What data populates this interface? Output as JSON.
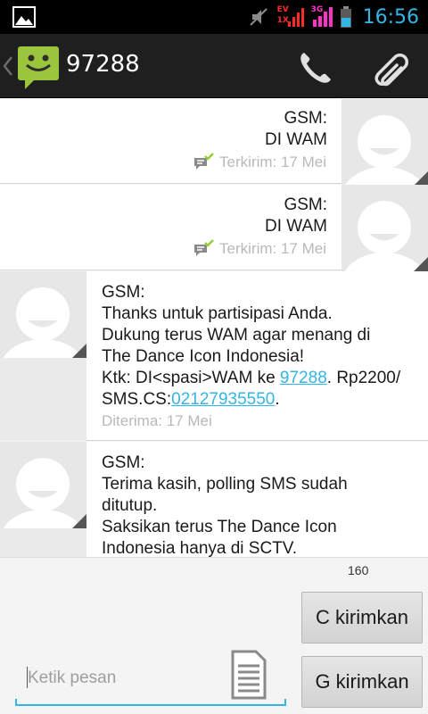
{
  "status_bar": {
    "time": "16:56",
    "icons": [
      "gallery-icon",
      "mute-icon",
      "signal-ev-icon",
      "signal-3g-icon",
      "battery-icon"
    ],
    "network_label_top": "EV",
    "network_label_bottom": "1X",
    "data_label": "3G"
  },
  "action_bar": {
    "title": "97288",
    "icons": [
      "back-caret-icon",
      "messaging-app-icon",
      "phone-icon",
      "paperclip-icon"
    ]
  },
  "messages": [
    {
      "direction": "sent",
      "lines": [
        "GSM:",
        "DI WAM"
      ],
      "status": "Terkirim: 17 Mei"
    },
    {
      "direction": "sent",
      "lines": [
        "GSM:",
        "DI WAM"
      ],
      "status": "Terkirim: 17 Mei"
    },
    {
      "direction": "received",
      "lines": [
        "GSM:",
        "Thanks untuk partisipasi Anda.",
        "Dukung terus WAM agar menang di",
        "The Dance Icon Indonesia!"
      ],
      "line5_prefix": "Ktk: DI<spasi>WAM ke ",
      "line5_link": "97288",
      "line5_suffix": ". Rp2200/",
      "line6_prefix": "SMS.CS:",
      "line6_link": "02127935550",
      "line6_suffix": ".",
      "status": "Diterima: 17 Mei"
    },
    {
      "direction": "received",
      "lines": [
        "GSM:",
        "Terima kasih, polling SMS sudah",
        "ditutup.",
        "Saksikan terus The Dance Icon",
        "Indonesia hanya di SCTV."
      ]
    }
  ],
  "compose": {
    "char_count": "160",
    "send_button_1": "C kirimkan",
    "send_button_2": "G kirimkan",
    "placeholder": "Ketik pesan"
  },
  "colors": {
    "accent": "#33b5e5",
    "action_bar": "#1f1f1f",
    "status_bar": "#000000",
    "app_icon_green": "#9bc53d",
    "delivered_check": "#9acd32"
  }
}
